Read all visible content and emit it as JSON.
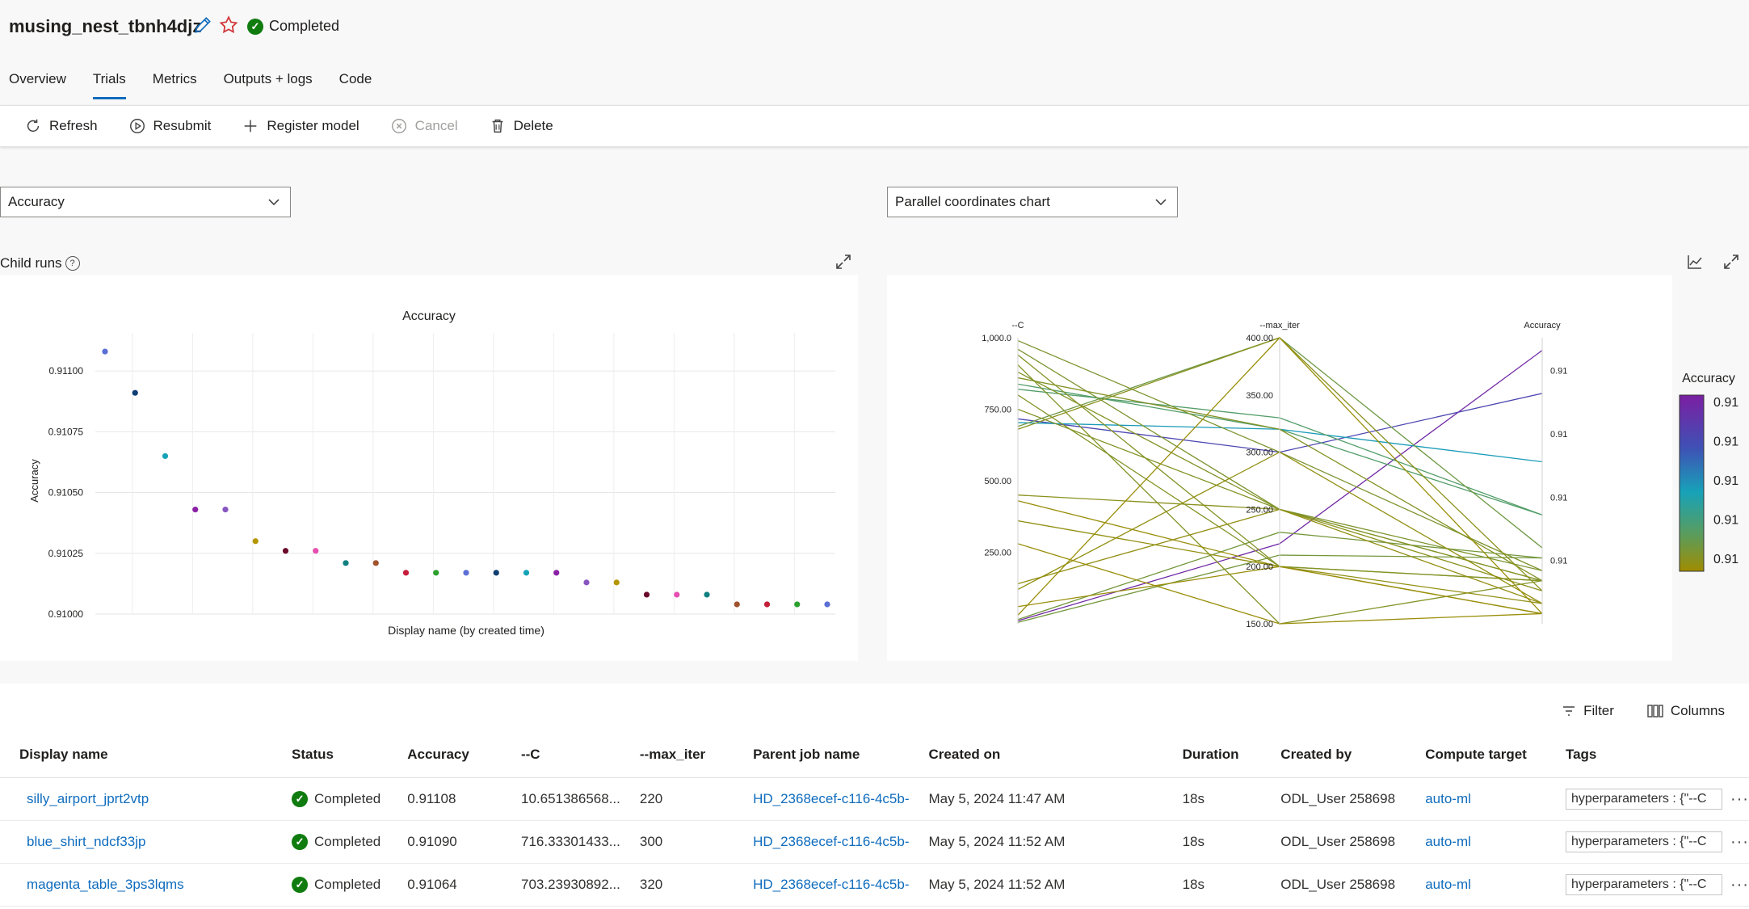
{
  "header": {
    "job_name": "musing_nest_tbnh4djz",
    "status": "Completed"
  },
  "tabs": [
    {
      "label": "Overview",
      "active": false
    },
    {
      "label": "Trials",
      "active": true
    },
    {
      "label": "Metrics",
      "active": false
    },
    {
      "label": "Outputs + logs",
      "active": false
    },
    {
      "label": "Code",
      "active": false
    }
  ],
  "toolbar": {
    "refresh": "Refresh",
    "resubmit": "Resubmit",
    "register_model": "Register model",
    "cancel": "Cancel",
    "delete": "Delete"
  },
  "metric_dropdown": {
    "value": "Accuracy"
  },
  "chart_type_dropdown": {
    "value": "Parallel coordinates chart"
  },
  "child_runs_label": "Child runs",
  "colors": {
    "accent": "#0f6cbd",
    "success": "#107c10",
    "scatter_points": [
      "#5b6fd6",
      "#0f3e73",
      "#17a2b8",
      "#8b20a6",
      "#8856c0",
      "#b49600",
      "#6b0a2a",
      "#e64fb1",
      "#107f7f",
      "#a0522d",
      "#c41e3a",
      "#2ca02c",
      "#5b6fd6",
      "#0f3e73",
      "#17a2b8",
      "#8b20a6",
      "#8856c0",
      "#b49600",
      "#6b0a2a",
      "#e64fb1",
      "#107f7f",
      "#a0522d",
      "#c41e3a",
      "#2ca02c",
      "#5b6fd6"
    ]
  },
  "chart_data": [
    {
      "type": "scatter",
      "title": "Accuracy",
      "xlabel": "Display name (by created time)",
      "ylabel": "Accuracy",
      "ylim": [
        0.91,
        0.91113
      ],
      "yticks": [
        "0.91000",
        "0.91025",
        "0.91050",
        "0.91075",
        "0.91100"
      ],
      "ytick_values": [
        0.91,
        0.91025,
        0.9105,
        0.91075,
        0.911
      ],
      "grid": true,
      "values": [
        0.91108,
        0.91091,
        0.91065,
        0.91043,
        0.91043,
        0.9103,
        0.91026,
        0.91026,
        0.91021,
        0.91021,
        0.91017,
        0.91017,
        0.91017,
        0.91017,
        0.91017,
        0.91017,
        0.91013,
        0.91013,
        0.91008,
        0.91008,
        0.91008,
        0.91004,
        0.91004,
        0.91004,
        0.91004
      ]
    },
    {
      "type": "line",
      "subtype": "parallel_coordinates",
      "axes": [
        {
          "name": "--C",
          "ticks": [
            "1,000.0",
            "750.00",
            "500.00",
            "250.00"
          ],
          "tick_values": [
            1000,
            750,
            500,
            250
          ],
          "range": [
            0,
            1000
          ]
        },
        {
          "name": "--max_iter",
          "ticks": [
            "400.00",
            "350.00",
            "300.00",
            "250.00",
            "200.00",
            "150.00"
          ],
          "tick_values": [
            400,
            350,
            300,
            250,
            200,
            150
          ],
          "range": [
            150,
            400
          ]
        },
        {
          "name": "Accuracy",
          "ticks": [
            "0.91",
            "0.91",
            "0.91",
            "0.91"
          ],
          "tick_values": [
            0.911,
            0.91075,
            0.9105,
            0.91025
          ],
          "range": [
            0.91,
            0.91113
          ]
        }
      ],
      "colorbar": {
        "title": "Accuracy",
        "labels": [
          "0.91",
          "0.91",
          "0.91",
          "0.91",
          "0.91"
        ]
      },
      "lines": [
        {
          "c": 10.65,
          "iter": 220,
          "acc": 0.91108
        },
        {
          "c": 716.33,
          "iter": 300,
          "acc": 0.91091
        },
        {
          "c": 703.24,
          "iter": 320,
          "acc": 0.91064
        },
        {
          "c": 838,
          "iter": 320,
          "acc": 0.91043
        },
        {
          "c": 820,
          "iter": 330,
          "acc": 0.91043
        },
        {
          "c": 690,
          "iter": 400,
          "acc": 0.9103
        },
        {
          "c": 5,
          "iter": 210,
          "acc": 0.91026
        },
        {
          "c": 15,
          "iter": 230,
          "acc": 0.91026
        },
        {
          "c": 990,
          "iter": 300,
          "acc": 0.91021
        },
        {
          "c": 960,
          "iter": 250,
          "acc": 0.91021
        },
        {
          "c": 940,
          "iter": 200,
          "acc": 0.91017
        },
        {
          "c": 905,
          "iter": 150,
          "acc": 0.91017
        },
        {
          "c": 880,
          "iter": 250,
          "acc": 0.91017
        },
        {
          "c": 860,
          "iter": 320,
          "acc": 0.91017
        },
        {
          "c": 800,
          "iter": 200,
          "acc": 0.91017
        },
        {
          "c": 750,
          "iter": 250,
          "acc": 0.91017
        },
        {
          "c": 680,
          "iter": 400,
          "acc": 0.91013
        },
        {
          "c": 450,
          "iter": 250,
          "acc": 0.91013
        },
        {
          "c": 360,
          "iter": 200,
          "acc": 0.91008
        },
        {
          "c": 140,
          "iter": 250,
          "acc": 0.91008
        },
        {
          "c": 120,
          "iter": 300,
          "acc": 0.91008
        },
        {
          "c": 60,
          "iter": 200,
          "acc": 0.91004
        },
        {
          "c": 30,
          "iter": 400,
          "acc": 0.91004
        },
        {
          "c": 280,
          "iter": 150,
          "acc": 0.91004
        },
        {
          "c": 430,
          "iter": 200,
          "acc": 0.91004
        }
      ]
    }
  ],
  "grid": {
    "filter": "Filter",
    "columns_btn": "Columns",
    "headers": [
      "Display name",
      "Status",
      "Accuracy",
      "--C",
      "--max_iter",
      "Parent job name",
      "Created on",
      "Duration",
      "Created by",
      "Compute target",
      "Tags"
    ],
    "rows": [
      {
        "name": "silly_airport_jprt2vtp",
        "status": "Completed",
        "accuracy": "0.91108",
        "c": "10.651386568...",
        "max_iter": "220",
        "parent": "HD_2368ecef-c116-4c5b-",
        "created": "May 5, 2024 11:47 AM",
        "duration": "18s",
        "created_by": "ODL_User 258698",
        "compute": "auto-ml",
        "tags": "hyperparameters : {\"--C"
      },
      {
        "name": "blue_shirt_ndcf33jp",
        "status": "Completed",
        "accuracy": "0.91090",
        "c": "716.33301433...",
        "max_iter": "300",
        "parent": "HD_2368ecef-c116-4c5b-",
        "created": "May 5, 2024 11:52 AM",
        "duration": "18s",
        "created_by": "ODL_User 258698",
        "compute": "auto-ml",
        "tags": "hyperparameters : {\"--C"
      },
      {
        "name": "magenta_table_3ps3lqms",
        "status": "Completed",
        "accuracy": "0.91064",
        "c": "703.23930892...",
        "max_iter": "320",
        "parent": "HD_2368ecef-c116-4c5b-",
        "created": "May 5, 2024 11:52 AM",
        "duration": "18s",
        "created_by": "ODL_User 258698",
        "compute": "auto-ml",
        "tags": "hyperparameters : {\"--C"
      }
    ]
  }
}
